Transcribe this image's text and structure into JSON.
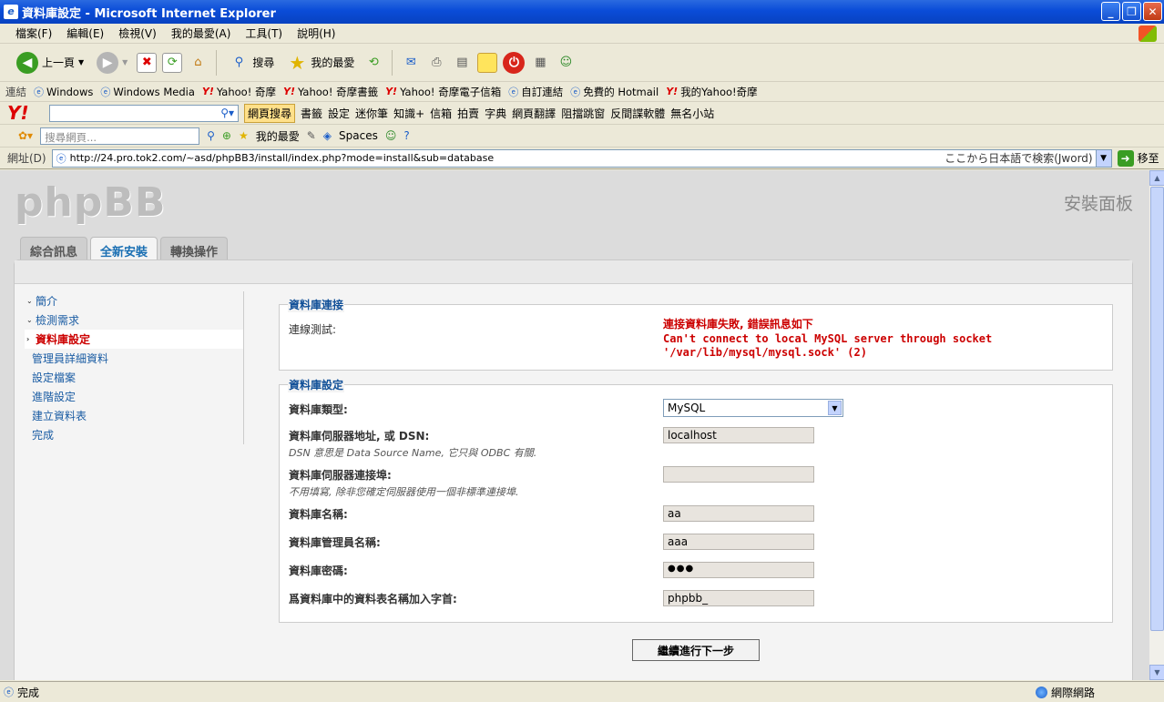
{
  "window": {
    "title": "資料庫設定 - Microsoft Internet Explorer"
  },
  "menu": [
    "檔案(F)",
    "編輯(E)",
    "檢視(V)",
    "我的最愛(A)",
    "工具(T)",
    "說明(H)"
  ],
  "toolbar": {
    "back": "上一頁",
    "search": "搜尋",
    "favorites": "我的最愛"
  },
  "links": {
    "label": "連結",
    "items": [
      "Windows",
      "Windows Media",
      "Yahoo! 奇摩",
      "Yahoo! 奇摩書籤",
      "Yahoo! 奇摩電子信箱",
      "自訂連結",
      "免費的 Hotmail",
      "我的Yahoo!奇摩"
    ]
  },
  "yahoo_bar": {
    "search_button": "網頁搜尋",
    "items": [
      "書籤",
      "設定",
      "迷你筆",
      "知識+",
      "信箱",
      "拍賣",
      "字典",
      "網頁翻譯",
      "阻擋跳窗",
      "反間諜軟體",
      "無名小站"
    ]
  },
  "msn_bar": {
    "placeholder": "搜尋網頁...",
    "favorites": "我的最愛",
    "spaces": "Spaces"
  },
  "address": {
    "label": "網址(D)",
    "url": "http://24.pro.tok2.com/~asd/phpBB3/install/index.php?mode=install&sub=database",
    "jp_search": "ここから日本語で検索(Jword)",
    "go": "移至"
  },
  "page": {
    "logo": "phpBB",
    "panel_title": "安裝面板",
    "tabs": [
      "綜合訊息",
      "全新安裝",
      "轉換操作"
    ],
    "nav": [
      "簡介",
      "檢測需求",
      "資料庫設定",
      "管理員詳細資料",
      "設定檔案",
      "進階設定",
      "建立資料表",
      "完成"
    ],
    "connection": {
      "legend": "資料庫連接",
      "test_label": "連線測試:",
      "error_title": "連接資料庫失敗, 錯誤訊息如下",
      "error_line1": "Can't connect to local MySQL server through socket",
      "error_line2": "'/var/lib/mysql/mysql.sock' (2)"
    },
    "settings": {
      "legend": "資料庫設定",
      "type_label": "資料庫類型:",
      "type_value": "MySQL",
      "host_label": "資料庫伺服器地址, 或 DSN:",
      "host_hint": "DSN 意思是 Data Source Name, 它只與 ODBC 有關.",
      "host_value": "localhost",
      "port_label": "資料庫伺服器連接埠:",
      "port_hint": "不用填寫, 除非您確定伺服器使用一個非標準連接埠.",
      "port_value": "",
      "name_label": "資料庫名稱:",
      "name_value": "aa",
      "user_label": "資料庫管理員名稱:",
      "user_value": "aaa",
      "pass_label": "資料庫密碼:",
      "pass_value": "●●●",
      "prefix_label": "爲資料庫中的資料表名稱加入字首:",
      "prefix_value": "phpbb_"
    },
    "submit": "繼續進行下一步"
  },
  "status": {
    "text": "完成",
    "zone": "網際網路"
  }
}
